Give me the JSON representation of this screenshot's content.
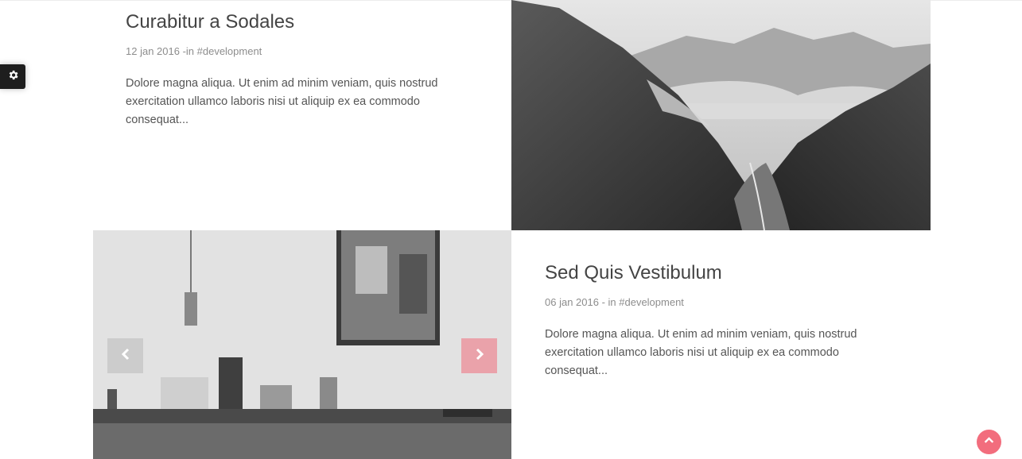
{
  "settings": {
    "icon": "gear-icon"
  },
  "posts": [
    {
      "title": "Curabitur a Sodales",
      "date": "12 jan 2016",
      "meta_sep": " -in ",
      "tag": "#development",
      "excerpt": "Dolore magna aliqua. Ut enim ad minim veniam, quis nostrud exercitation ullamco laboris nisi ut aliquip ex ea commodo consequat..."
    },
    {
      "title": "Sed Quis Vestibulum",
      "date": "06 jan 2016",
      "meta_sep": " - in ",
      "tag": "#development",
      "excerpt": "Dolore magna aliqua. Ut enim ad minim veniam, quis nostrud exercitation ullamco laboris nisi ut aliquip ex ea commodo consequat..."
    }
  ],
  "slider": {
    "prev_icon": "chevron-left-icon",
    "next_icon": "chevron-right-icon"
  },
  "back_to_top": {
    "icon": "chevron-up-icon",
    "color": "#f26d7d"
  }
}
